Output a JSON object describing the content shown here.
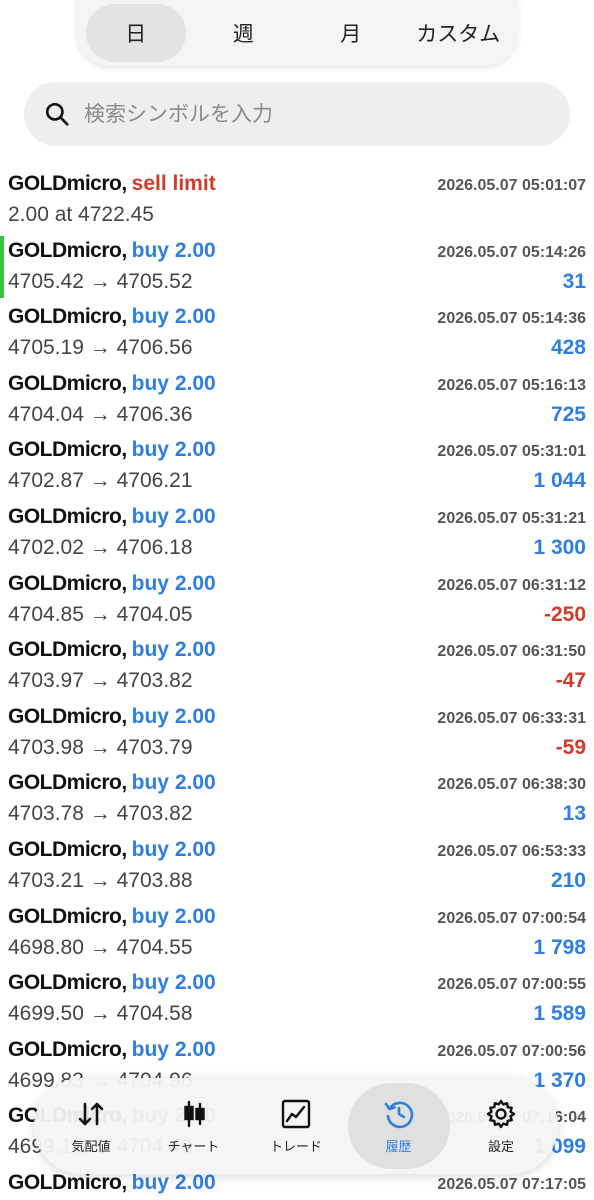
{
  "period_tabs": [
    {
      "label": "日",
      "active": true
    },
    {
      "label": "週",
      "active": false
    },
    {
      "label": "月",
      "active": false
    },
    {
      "label": "カスタム",
      "active": false
    }
  ],
  "search": {
    "placeholder": "検索シンボルを入力",
    "icon": "search-icon"
  },
  "separator": ",",
  "arrow": "→",
  "colors": {
    "buy": "#2f7fe0",
    "sell": "#d23a2a",
    "positive": "#2f7fe0",
    "negative": "#d23a2a",
    "marker": "#3cbf49"
  },
  "orders": [
    {
      "symbol": "GOLDmicro",
      "type": "sell limit",
      "side": "sell",
      "time": "2026.05.07 05:01:07",
      "detail": "2.00 at 4722.45"
    },
    {
      "symbol": "GOLDmicro",
      "type": "buy 2.00",
      "side": "buy",
      "time": "2026.05.07 05:14:26",
      "open": "4705.42",
      "close": "4705.52",
      "profit": "31",
      "selected": true
    },
    {
      "symbol": "GOLDmicro",
      "type": "buy 2.00",
      "side": "buy",
      "time": "2026.05.07 05:14:36",
      "open": "4705.19",
      "close": "4706.56",
      "profit": "428"
    },
    {
      "symbol": "GOLDmicro",
      "type": "buy 2.00",
      "side": "buy",
      "time": "2026.05.07 05:16:13",
      "open": "4704.04",
      "close": "4706.36",
      "profit": "725"
    },
    {
      "symbol": "GOLDmicro",
      "type": "buy 2.00",
      "side": "buy",
      "time": "2026.05.07 05:31:01",
      "open": "4702.87",
      "close": "4706.21",
      "profit": "1 044"
    },
    {
      "symbol": "GOLDmicro",
      "type": "buy 2.00",
      "side": "buy",
      "time": "2026.05.07 05:31:21",
      "open": "4702.02",
      "close": "4706.18",
      "profit": "1 300"
    },
    {
      "symbol": "GOLDmicro",
      "type": "buy 2.00",
      "side": "buy",
      "time": "2026.05.07 06:31:12",
      "open": "4704.85",
      "close": "4704.05",
      "profit": "-250"
    },
    {
      "symbol": "GOLDmicro",
      "type": "buy 2.00",
      "side": "buy",
      "time": "2026.05.07 06:31:50",
      "open": "4703.97",
      "close": "4703.82",
      "profit": "-47"
    },
    {
      "symbol": "GOLDmicro",
      "type": "buy 2.00",
      "side": "buy",
      "time": "2026.05.07 06:33:31",
      "open": "4703.98",
      "close": "4703.79",
      "profit": "-59"
    },
    {
      "symbol": "GOLDmicro",
      "type": "buy 2.00",
      "side": "buy",
      "time": "2026.05.07 06:38:30",
      "open": "4703.78",
      "close": "4703.82",
      "profit": "13"
    },
    {
      "symbol": "GOLDmicro",
      "type": "buy 2.00",
      "side": "buy",
      "time": "2026.05.07 06:53:33",
      "open": "4703.21",
      "close": "4703.88",
      "profit": "210"
    },
    {
      "symbol": "GOLDmicro",
      "type": "buy 2.00",
      "side": "buy",
      "time": "2026.05.07 07:00:54",
      "open": "4698.80",
      "close": "4704.55",
      "profit": "1 798"
    },
    {
      "symbol": "GOLDmicro",
      "type": "buy 2.00",
      "side": "buy",
      "time": "2026.05.07 07:00:55",
      "open": "4699.50",
      "close": "4704.58",
      "profit": "1 589"
    },
    {
      "symbol": "GOLDmicro",
      "type": "buy 2.00",
      "side": "buy",
      "time": "2026.05.07 07:00:56",
      "open": "4699.83",
      "close": "4704.96",
      "profit": "1 370"
    },
    {
      "symbol": "GOLDmicro",
      "type": "buy 2.00",
      "side": "buy",
      "time": "2026.05.07 07:16:04",
      "open": "4699.10",
      "close": "4704.40",
      "profit": "1 099"
    },
    {
      "symbol": "GOLDmicro",
      "type": "buy 2.00",
      "side": "buy",
      "time": "2026.05.07 07:17:05",
      "open": "",
      "close": "",
      "profit": ""
    }
  ],
  "bottom_nav": [
    {
      "label": "気配値",
      "icon": "quotes-arrows-icon",
      "active": false
    },
    {
      "label": "チャート",
      "icon": "candlestick-chart-icon",
      "active": false
    },
    {
      "label": "トレード",
      "icon": "trade-line-chart-icon",
      "active": false
    },
    {
      "label": "履歴",
      "icon": "history-clock-icon",
      "active": true
    },
    {
      "label": "設定",
      "icon": "gear-icon",
      "active": false
    }
  ]
}
